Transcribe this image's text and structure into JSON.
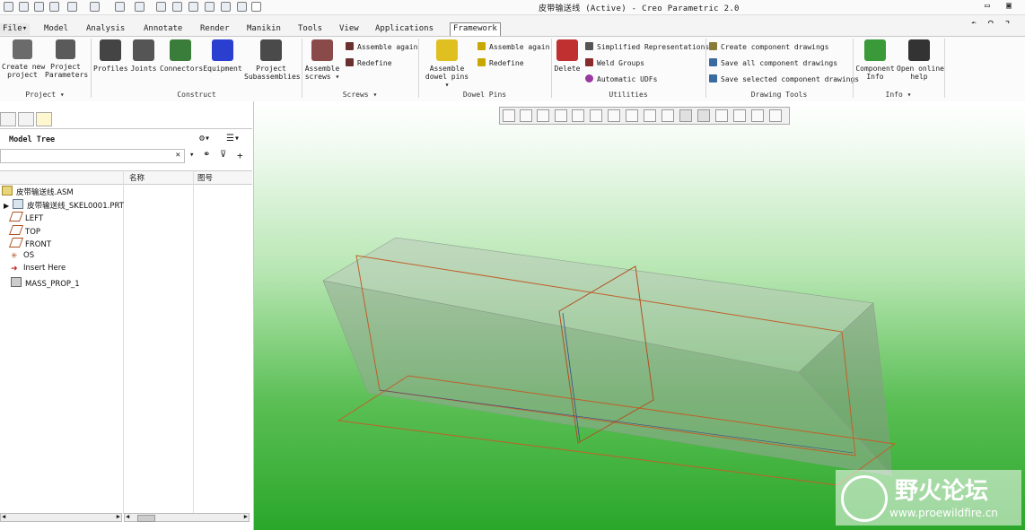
{
  "window": {
    "title": "皮带输送线 (Active) - Creo Parametric 2.0",
    "controls": [
      "minimize-icon",
      "maximize-icon",
      "close-icon"
    ]
  },
  "menu_tabs": [
    "File",
    "Model",
    "Analysis",
    "Annotate",
    "Render",
    "Manikin",
    "Tools",
    "View",
    "Applications",
    "Framework"
  ],
  "active_tab": "Framework",
  "ribbon": {
    "project": {
      "label": "Project",
      "buttons": [
        "Create new\nproject",
        "Project\nParameters"
      ]
    },
    "construct": {
      "label": "Construct",
      "buttons": [
        "Profiles",
        "Joints",
        "Connectors",
        "Equipment",
        "Project\nSubassemblies"
      ]
    },
    "screws": {
      "label": "Screws",
      "big": "Assemble\nscrews",
      "small": [
        "Assemble again",
        "Redefine"
      ]
    },
    "dowel": {
      "label": "Dowel Pins",
      "big": "Assemble\ndowel pins",
      "small": [
        "Assemble again",
        "Redefine"
      ]
    },
    "utilities": {
      "label": "Utilities",
      "big": "Delete",
      "small": [
        "Simplified Representations",
        "Weld Groups",
        "Automatic UDFs"
      ]
    },
    "drawing": {
      "label": "Drawing Tools",
      "small": [
        "Create component drawings",
        "Save all component drawings",
        "Save selected component drawings"
      ]
    },
    "info": {
      "label": "Info",
      "buttons": [
        "Component\nInfo",
        "Open online\nhelp"
      ]
    }
  },
  "model_tree": {
    "title": "Model Tree",
    "search_value": "",
    "columns": [
      "名称",
      "图号"
    ],
    "items": [
      {
        "label": "皮带输送线.ASM",
        "icon": "assembly-icon"
      },
      {
        "label": "皮带输送线_SKEL0001.PRT",
        "icon": "part-icon"
      },
      {
        "label": "LEFT",
        "icon": "datum-plane-icon"
      },
      {
        "label": "TOP",
        "icon": "datum-plane-icon"
      },
      {
        "label": "FRONT",
        "icon": "datum-plane-icon"
      },
      {
        "label": "OS",
        "icon": "coordinate-system-icon"
      },
      {
        "label": "Insert Here",
        "icon": "insert-arrow-icon"
      },
      {
        "label": "MASS_PROP_1",
        "icon": "mass-prop-icon"
      }
    ]
  },
  "watermark": {
    "name": "野火论坛",
    "url": "www.proewildfire.cn"
  },
  "colors": {
    "accent": "#2aa72a",
    "edge": "#c0602a",
    "box": "#9aa89a"
  }
}
